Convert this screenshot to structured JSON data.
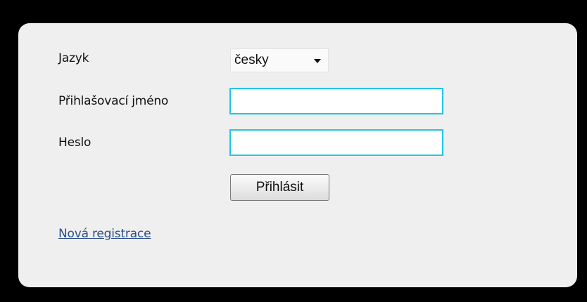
{
  "form": {
    "language_label": "Jazyk",
    "language_value": "česky",
    "username_label": "Přihlašovací jméno",
    "username_value": "",
    "password_label": "Heslo",
    "password_value": "",
    "login_button": "Přihlásit",
    "register_link": "Nová registrace"
  },
  "colors": {
    "page_background": "#000000",
    "panel_background": "#efefef",
    "input_border": "#21c6e8",
    "link": "#2b4f8c"
  },
  "icons": {
    "language_dropdown": "triangle-down-icon"
  }
}
